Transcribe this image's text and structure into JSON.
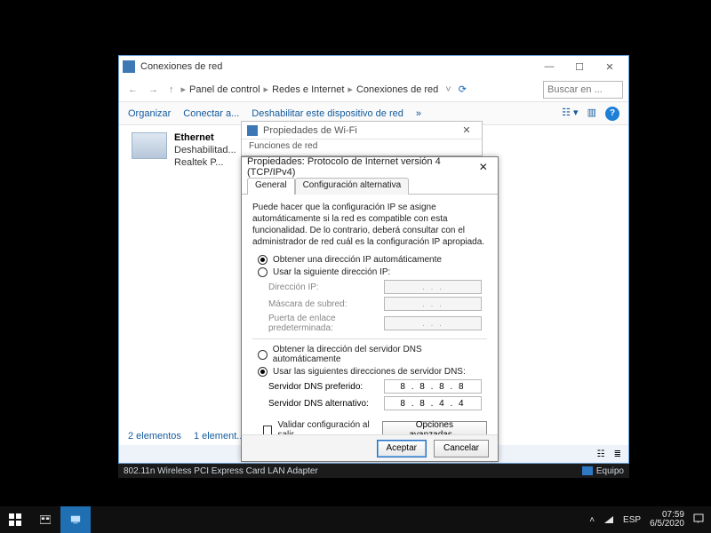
{
  "cp": {
    "title": "Conexiones de red",
    "crumbs": [
      "Panel de control",
      "Redes e Internet",
      "Conexiones de red"
    ],
    "search_placeholder": "Buscar en ...",
    "toolbar": {
      "organize": "Organizar",
      "connect": "Conectar a...",
      "disable": "Deshabilitar este dispositivo de red",
      "more": "»"
    },
    "adapter": {
      "name": "Ethernet",
      "status": "Deshabilitad...",
      "device": "Realtek P..."
    },
    "status_left": "2 elementos",
    "status_right": "1 element..."
  },
  "wifi": {
    "title": "Propiedades de Wi-Fi",
    "subtitle": "Funciones de red"
  },
  "dlg": {
    "title": "Propiedades: Protocolo de Internet versión 4 (TCP/IPv4)",
    "tabs": {
      "general": "General",
      "alt": "Configuración alternativa"
    },
    "desc": "Puede hacer que la configuración IP se asigne automáticamente si la red es compatible con esta funcionalidad. De lo contrario, deberá consultar con el administrador de red cuál es la configuración IP apropiada.",
    "ip_auto": "Obtener una dirección IP automáticamente",
    "ip_manual": "Usar la siguiente dirección IP:",
    "ip_fields": {
      "addr": "Dirección IP:",
      "mask": "Máscara de subred:",
      "gw": "Puerta de enlace predeterminada:"
    },
    "dns_auto": "Obtener la dirección del servidor DNS automáticamente",
    "dns_manual": "Usar las siguientes direcciones de servidor DNS:",
    "dns_pref_label": "Servidor DNS preferido:",
    "dns_pref_value": "8 . 8 . 8 . 8",
    "dns_alt_label": "Servidor DNS alternativo:",
    "dns_alt_value": "8 . 8 . 4 . 4",
    "validate": "Validar configuración al salir",
    "advanced": "Opciones avanzadas...",
    "ok": "Aceptar",
    "cancel": "Cancelar"
  },
  "device_strip": {
    "text": "802.11n Wireless PCI Express Card LAN Adapter",
    "equipo": "Equipo"
  },
  "taskbar": {
    "lang": "ESP",
    "time": "07:59",
    "date": "6/5/2020"
  }
}
